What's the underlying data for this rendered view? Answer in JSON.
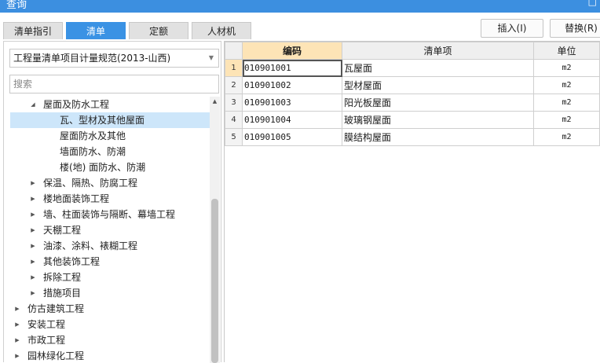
{
  "window": {
    "title": "查询",
    "control_icon": "restore-icon"
  },
  "tabs": [
    {
      "label": "清单指引",
      "active": false
    },
    {
      "label": "清单",
      "active": true
    },
    {
      "label": "定额",
      "active": false
    },
    {
      "label": "人材机",
      "active": false
    }
  ],
  "toolbar": {
    "insert_label": "插入(I)",
    "replace_label": "替换(R)"
  },
  "library": {
    "selected": "工程量清单项目计量规范(2013-山西)",
    "search_placeholder": "搜索"
  },
  "tree": [
    {
      "label": "屋面及防水工程",
      "expanded": true,
      "selected": false
    },
    {
      "label": "瓦、型材及其他屋面",
      "selected": true
    },
    {
      "label": "屋面防水及其他",
      "selected": false
    },
    {
      "label": "墙面防水、防潮",
      "selected": false
    },
    {
      "label": "楼(地) 面防水、防潮",
      "selected": false
    },
    {
      "label": "保温、隔热、防腐工程",
      "expanded": false
    },
    {
      "label": "楼地面装饰工程",
      "expanded": false
    },
    {
      "label": "墙、柱面装饰与隔断、幕墙工程",
      "expanded": false
    },
    {
      "label": "天棚工程",
      "expanded": false
    },
    {
      "label": "油漆、涂料、裱糊工程",
      "expanded": false
    },
    {
      "label": "其他装饰工程",
      "expanded": false
    },
    {
      "label": "拆除工程",
      "expanded": false
    },
    {
      "label": "措施项目",
      "expanded": false
    },
    {
      "label": "仿古建筑工程",
      "expanded": false
    },
    {
      "label": "安装工程",
      "expanded": false
    },
    {
      "label": "市政工程",
      "expanded": false
    },
    {
      "label": "园林绿化工程",
      "expanded": false
    }
  ],
  "grid": {
    "columns": {
      "code": "编码",
      "name": "清单项",
      "unit": "单位"
    },
    "rows": [
      {
        "no": "1",
        "code": "010901001",
        "name": "瓦屋面",
        "unit": "m2"
      },
      {
        "no": "2",
        "code": "010901002",
        "name": "型材屋面",
        "unit": "m2"
      },
      {
        "no": "3",
        "code": "010901003",
        "name": "阳光板屋面",
        "unit": "m2"
      },
      {
        "no": "4",
        "code": "010901004",
        "name": "玻璃钢屋面",
        "unit": "m2"
      },
      {
        "no": "5",
        "code": "010901005",
        "name": "膜结构屋面",
        "unit": "m2"
      }
    ]
  },
  "colors": {
    "accent": "#3a92e4",
    "header_highlight": "#fde4b6",
    "tree_selected": "#cde6fa"
  }
}
